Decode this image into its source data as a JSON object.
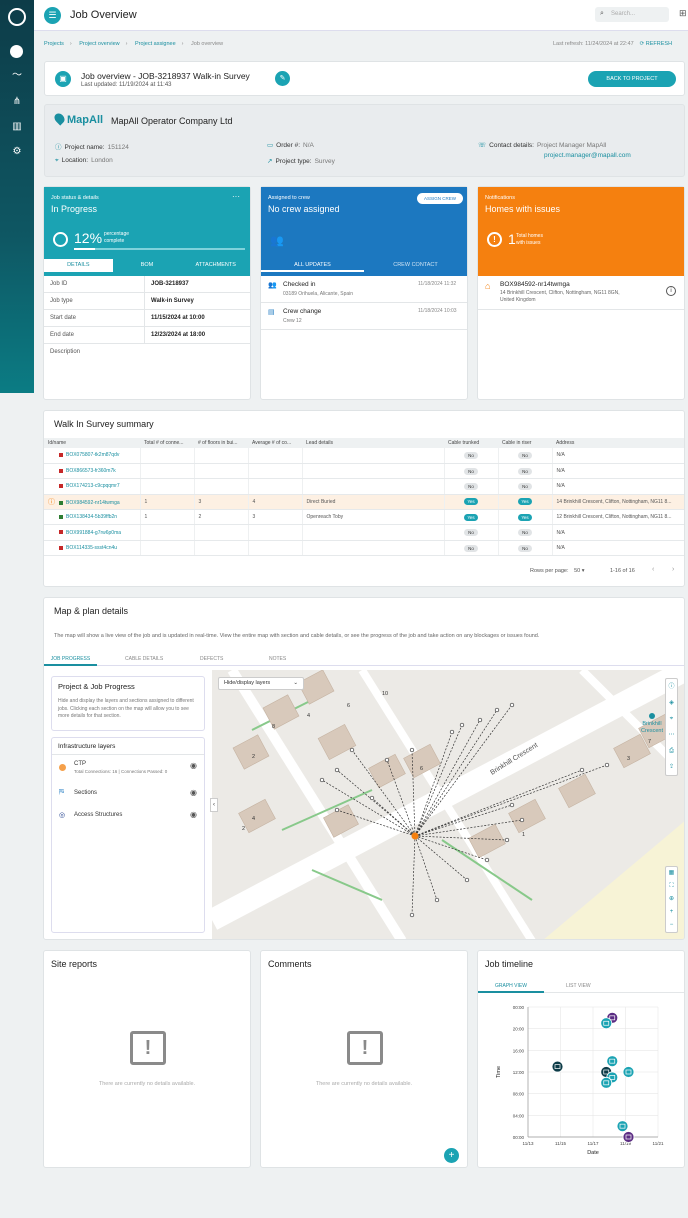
{
  "app": {
    "title": "Job Overview",
    "search_placeholder": "Search..."
  },
  "breadcrumb": [
    "Projects",
    "Project overview",
    "Project assignee",
    "Job overview"
  ],
  "refresh": {
    "last": "Last refresh: 11/24/2024 at 22:47",
    "label": "REFRESH"
  },
  "header": {
    "title": "Job overview - JOB-3218937 Walk-in Survey",
    "updated": "Last updated: 11/19/2024 at 11:43",
    "back_label": "BACK TO PROJECT"
  },
  "project": {
    "logo_text": "MapAll",
    "operator": "MapAll Operator Company Ltd",
    "name_label": "Project name:",
    "name": "151124",
    "location_label": "Location:",
    "location": "London",
    "order_label": "Order #:",
    "order": "N/A",
    "type_label": "Project type:",
    "type": "Survey",
    "contact_label": "Contact details:",
    "contact_name": "Project Manager MapAll",
    "contact_email": "project.manager@mapall.com"
  },
  "status_card": {
    "small": "Job status & details",
    "status": "In Progress",
    "percent": "12%",
    "percent_caption1": "percentage",
    "percent_caption2": "complete",
    "progress": 0.12,
    "tabs": [
      "DETAILS",
      "BOM",
      "ATTACHMENTS"
    ],
    "rows": [
      {
        "k": "Job ID",
        "v": "JOB-3218937"
      },
      {
        "k": "Job type",
        "v": "Walk-in Survey"
      },
      {
        "k": "Start date",
        "v": "11/15/2024 at 10:00"
      },
      {
        "k": "End date",
        "v": "12/23/2024 at 18:00"
      },
      {
        "k": "Description",
        "v": ""
      }
    ]
  },
  "crew_card": {
    "small": "Assigned to crew",
    "title": "No crew assigned",
    "assign_label": "ASSIGN CREW",
    "tabs": [
      "ALL UPDATES",
      "CREW CONTACT"
    ],
    "updates": [
      {
        "title": "Checked in",
        "sub": "03189 Orihuela, Alicante, Spain",
        "time": "11/18/2024 11:32"
      },
      {
        "title": "Crew change",
        "sub": "Crew 12",
        "time": "11/18/2024 10:03"
      }
    ]
  },
  "notif_card": {
    "small": "Notifications",
    "title": "Homes with issues",
    "count": "1",
    "caption1": "Total homes",
    "caption2": "with issues",
    "item_id": "BOX984592-nr14twmga",
    "item_addr1": "14 Brinkhill Crescent, Clifton, Nottingham, NG11 8GN,",
    "item_addr2": "United Kingdom"
  },
  "survey": {
    "title": "Walk In Survey summary",
    "columns": [
      "Id/name",
      "Total # of conne...",
      "# of floors in bui...",
      "Average # of co...",
      "Lead details",
      "Cable trunked",
      "Cable in riser",
      "Address"
    ],
    "rows": [
      {
        "id": "BOX075807-tk2m87qdv",
        "c": "",
        "f": "",
        "a": "",
        "lead": "",
        "t": "No",
        "r": "No",
        "addr": "N/A",
        "color": "#c62828",
        "warn": false
      },
      {
        "id": "BOX866573-fr360m7k",
        "c": "",
        "f": "",
        "a": "",
        "lead": "",
        "t": "No",
        "r": "No",
        "addr": "N/A",
        "color": "#c62828",
        "warn": false
      },
      {
        "id": "BOX174213-c9cpqqmr7",
        "c": "",
        "f": "",
        "a": "",
        "lead": "",
        "t": "No",
        "r": "No",
        "addr": "N/A",
        "color": "#c62828",
        "warn": false
      },
      {
        "id": "BOX984592-nr14twmga",
        "c": "1",
        "f": "3",
        "a": "4",
        "lead": "Direct Buried",
        "t": "Yes",
        "r": "Yes",
        "addr": "14 Brinkhill Crescent, Clifton, Nottingham, NG11 8...",
        "color": "#2e7d32",
        "warn": true
      },
      {
        "id": "BOX138434-5b39ffb2n",
        "c": "1",
        "f": "2",
        "a": "3",
        "lead": "Openreach Toby",
        "t": "Yes",
        "r": "Yes",
        "addr": "12 Brinkhill Crescent, Clifton, Nottingham, NG11 8...",
        "color": "#2e7d32",
        "warn": false
      },
      {
        "id": "BOX991884-g7rw6p0ma",
        "c": "",
        "f": "",
        "a": "",
        "lead": "",
        "t": "No",
        "r": "No",
        "addr": "N/A",
        "color": "#c62828",
        "warn": false
      },
      {
        "id": "BOX114335-ssst4cn4u",
        "c": "",
        "f": "",
        "a": "",
        "lead": "",
        "t": "No",
        "r": "No",
        "addr": "N/A",
        "color": "#c62828",
        "warn": false
      }
    ],
    "rows_per_page_label": "Rows per page:",
    "rows_per_page": "50",
    "range": "1-16 of 16"
  },
  "map_section": {
    "title": "Map & plan details",
    "desc": "The map will show a live view of the job and is updated in real-time. View the entire map with section and cable details, or see the progress of the job and take action on any blockages or issues found.",
    "tabs": [
      "JOB PROGRESS",
      "CABLE DETAILS",
      "DEFECTS",
      "NOTES"
    ],
    "panel_title": "Project & Job Progress",
    "panel_desc": "Hide and display the layers and sections assigned to different jobs. Clicking each section on the map will allow you to see more details for that section.",
    "layers_title": "Infrastructure layers",
    "layers": [
      {
        "name": "CTP",
        "sub": "Total Connections: 16 | Connections Passed: 0"
      },
      {
        "name": "Sections",
        "sub": ""
      },
      {
        "name": "Access Structures",
        "sub": ""
      }
    ],
    "layer_select": "Hide/display layers",
    "street": "Brinkhill Crescent",
    "poi": [
      "Brinkhill",
      "Crescent"
    ],
    "house_numbers": [
      "4",
      "6",
      "2",
      "8",
      "10",
      "2",
      "4",
      "6",
      "1",
      "3",
      "7"
    ]
  },
  "site_reports": {
    "title": "Site reports",
    "empty": "There are currently no details available."
  },
  "comments": {
    "title": "Comments",
    "empty": "There are currently no details available.",
    "add": "+"
  },
  "timeline": {
    "title": "Job timeline",
    "tabs": [
      "GRAPH VIEW",
      "LIST VIEW"
    ],
    "chart_data": {
      "type": "scatter",
      "xlabel": "Date",
      "ylabel": "Time",
      "x_ticks": [
        "11/13",
        "11/15",
        "11/17",
        "11/19",
        "11/21"
      ],
      "y_ticks": [
        "00:00",
        "04:00",
        "08:00",
        "12:00",
        "16:00",
        "20:00",
        "00:00"
      ],
      "points": [
        {
          "date": "11/15",
          "hour": 13.0,
          "kind": "checklist",
          "color": "#0d3c48"
        },
        {
          "date": "11/18",
          "hour": 22.0,
          "kind": "crew-change",
          "color": "#5b2c83"
        },
        {
          "date": "11/18",
          "hour": 21.0,
          "kind": "crew",
          "color": "#1ba3b3"
        },
        {
          "date": "11/18",
          "hour": 14.0,
          "kind": "crew",
          "color": "#1ba3b3"
        },
        {
          "date": "11/18",
          "hour": 12.0,
          "kind": "group",
          "color": "#0d3c48"
        },
        {
          "date": "11/18",
          "hour": 11.0,
          "kind": "crew",
          "color": "#1ba3b3"
        },
        {
          "date": "11/18",
          "hour": 10.0,
          "kind": "crew",
          "color": "#1ba3b3"
        },
        {
          "date": "11/19",
          "hour": 12.0,
          "kind": "crew",
          "color": "#1ba3b3"
        },
        {
          "date": "11/19",
          "hour": 2.0,
          "kind": "crew",
          "color": "#1ba3b3"
        },
        {
          "date": "11/19",
          "hour": 0.0,
          "kind": "crew-change",
          "color": "#5b2c83"
        }
      ]
    }
  }
}
